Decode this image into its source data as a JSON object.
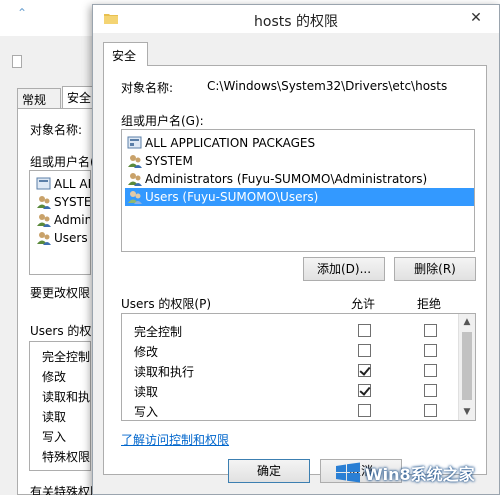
{
  "background_window": {
    "tabs": [
      "常规",
      "安全"
    ],
    "object_label": "对象名称:",
    "group_label": "组或用户名(",
    "users": [
      "ALL AP",
      "SYSTEM",
      "Admini",
      "Users ("
    ],
    "change_perm_label": "要更改权限",
    "perm_label": "Users 的权限",
    "perms": [
      "完全控制",
      "修改",
      "读取和执行",
      "读取",
      "写入",
      "特殊权限"
    ],
    "footer_text": "有关特殊权限"
  },
  "dialog": {
    "title": "hosts 的权限",
    "close_glyph": "✕",
    "tab_label": "安全",
    "object_name_label": "对象名称:",
    "object_name_value": "C:\\Windows\\System32\\Drivers\\etc\\hosts",
    "group_label": "组或用户名(G):",
    "users": [
      {
        "label": "ALL APPLICATION PACKAGES",
        "icon": "app-packages-icon",
        "selected": false
      },
      {
        "label": "SYSTEM",
        "icon": "users-group-icon",
        "selected": false
      },
      {
        "label": "Administrators (Fuyu-SUMOMO\\Administrators)",
        "icon": "users-group-icon",
        "selected": false
      },
      {
        "label": "Users (Fuyu-SUMOMO\\Users)",
        "icon": "users-group-icon",
        "selected": true
      }
    ],
    "add_button": "添加(D)...",
    "remove_button": "删除(R)",
    "perm_header": "Users 的权限(P)",
    "allow_header": "允许",
    "deny_header": "拒绝",
    "permissions": [
      {
        "name": "完全控制",
        "allow": false,
        "deny": false
      },
      {
        "name": "修改",
        "allow": false,
        "deny": false
      },
      {
        "name": "读取和执行",
        "allow": true,
        "deny": false
      },
      {
        "name": "读取",
        "allow": true,
        "deny": false
      },
      {
        "name": "写入",
        "allow": false,
        "deny": false
      }
    ],
    "link_text": "了解访问控制和权限",
    "ok_button": "确定",
    "cancel_button": "取消"
  },
  "watermark": {
    "text": "Win8系统之家"
  },
  "colors": {
    "selection": "#3399ff",
    "link": "#0066cc",
    "dialog_bg": "#f0f0f0"
  }
}
